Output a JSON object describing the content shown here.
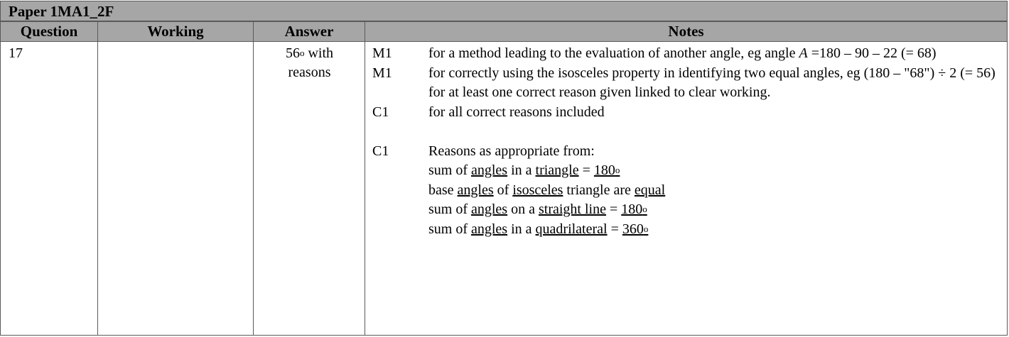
{
  "paper": "Paper 1MA1_2F",
  "headers": {
    "question": "Question",
    "working": "Working",
    "answer": "Answer",
    "notes": "Notes"
  },
  "row": {
    "question": "17",
    "working": "",
    "answer": {
      "value": "56",
      "degree": "o",
      "suffix": " with",
      "line2": "reasons"
    },
    "notes": [
      {
        "mark": "M1",
        "text": "for a method leading to the evaluation of another angle, eg angle ",
        "italic": "A",
        "text2": " =180 – 90 – 22 (= 68)"
      },
      {
        "mark": "M1",
        "text": "for correctly using the isosceles property in identifying two equal angles, eg (180 – \"68\") ÷ 2 (= 56)"
      },
      {
        "mark": "",
        "text": "for at least one correct reason given linked to clear working."
      },
      {
        "mark": "C1",
        "text": "for all correct reasons included"
      },
      {
        "mark": "C1",
        "text": "Reasons as appropriate from:"
      }
    ],
    "reasons": [
      {
        "p1": "sum of ",
        "u1": "angles",
        "p2": " in a ",
        "u2": "triangle",
        "p3": " = ",
        "u3": "180",
        "deg": "o"
      },
      {
        "p1": "base ",
        "u1": "angles",
        "p2": " of ",
        "u2": "isosceles",
        "p3": " triangle are ",
        "u3": "equal",
        "deg": ""
      },
      {
        "p1": "sum of ",
        "u1": "angles",
        "p2": " on a ",
        "u2": "straight line",
        "p3": " = ",
        "u3": "180",
        "deg": "o"
      },
      {
        "p1": "sum of ",
        "u1": "angles",
        "p2": " in a ",
        "u2": "quadrilateral",
        "p3": " = ",
        "u3": "360",
        "deg": "o"
      }
    ]
  }
}
